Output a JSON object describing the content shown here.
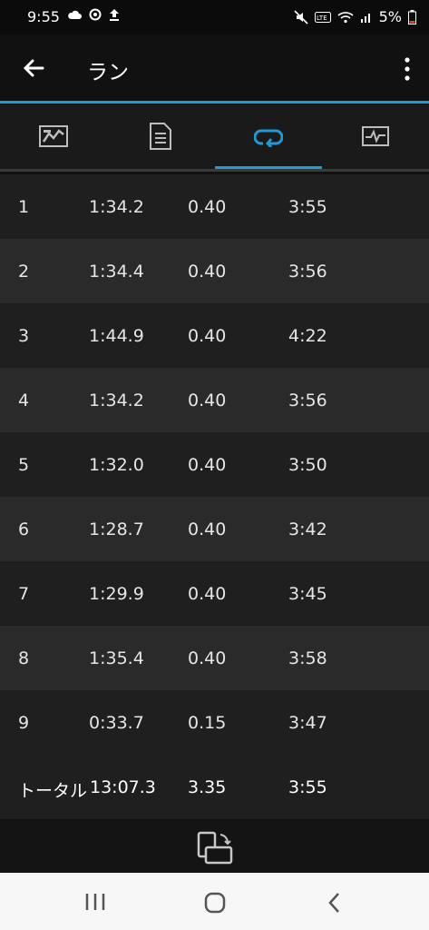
{
  "status": {
    "time": "9:55",
    "battery": "5%",
    "icons": [
      "cloud-icon",
      "sync-icon",
      "upload-icon",
      "mute-icon",
      "volte-icon",
      "wifi-icon",
      "signal-icon",
      "battery-icon"
    ]
  },
  "appbar": {
    "title": "ラン"
  },
  "tabs": [
    {
      "name": "chart-tab",
      "icon": "chart-icon"
    },
    {
      "name": "details-tab",
      "icon": "document-icon"
    },
    {
      "name": "laps-tab",
      "icon": "lap-icon",
      "active": true
    },
    {
      "name": "graph-tab",
      "icon": "pulse-icon"
    }
  ],
  "laps": [
    {
      "lap": "1",
      "time": "1:34.2",
      "distance": "0.40",
      "pace": "3:55"
    },
    {
      "lap": "2",
      "time": "1:34.4",
      "distance": "0.40",
      "pace": "3:56"
    },
    {
      "lap": "3",
      "time": "1:44.9",
      "distance": "0.40",
      "pace": "4:22"
    },
    {
      "lap": "4",
      "time": "1:34.2",
      "distance": "0.40",
      "pace": "3:56"
    },
    {
      "lap": "5",
      "time": "1:32.0",
      "distance": "0.40",
      "pace": "3:50"
    },
    {
      "lap": "6",
      "time": "1:28.7",
      "distance": "0.40",
      "pace": "3:42"
    },
    {
      "lap": "7",
      "time": "1:29.9",
      "distance": "0.40",
      "pace": "3:45"
    },
    {
      "lap": "8",
      "time": "1:35.4",
      "distance": "0.40",
      "pace": "3:58"
    },
    {
      "lap": "9",
      "time": "0:33.7",
      "distance": "0.15",
      "pace": "3:47"
    }
  ],
  "total": {
    "label": "トータル",
    "time": "13:07.3",
    "distance": "3.35",
    "pace": "3:55"
  },
  "colors": {
    "accent": "#1e9ad6",
    "background": "#111111"
  }
}
